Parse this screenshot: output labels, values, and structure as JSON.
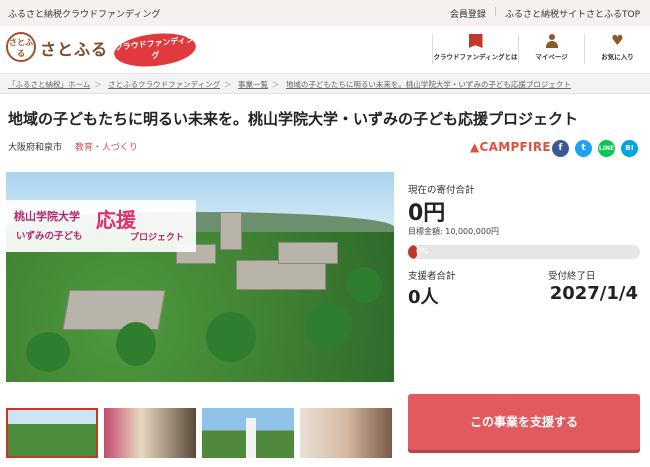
{
  "topbar": {
    "tagline": "ふるさと納税クラウドファンディング",
    "links": [
      "会員登録",
      "ふるさと納税サイトさとふるTOP"
    ]
  },
  "header": {
    "logo_mark": "さとふる",
    "logo_text": "さとふる",
    "cf_badge": "クラウドファンディング",
    "nav": [
      {
        "label": "クラウドファンディングとは",
        "icon": "book-icon"
      },
      {
        "label": "マイページ",
        "icon": "person-icon"
      },
      {
        "label": "お気に入り",
        "icon": "heart-icon"
      }
    ]
  },
  "breadcrumb": [
    "「ふるさと納税」ホーム",
    "さとふるクラウドファンディング",
    "事業一覧",
    "地域の子どもたちに明るい未来を。桃山学院大学・いずみの子ども応援プロジェクト"
  ],
  "project": {
    "title": "地域の子どもたちに明るい未来を。桃山学院大学・いずみの子ども応援プロジェクト",
    "location": "大阪府和泉市",
    "category": "教育・人づくり",
    "platform": "CAMPFIRE",
    "banner_line1": "桃山学院大学",
    "banner_line2": "いずみの子ども",
    "banner_big": "応援",
    "banner_small": "プロジェクト"
  },
  "share": {
    "facebook": "f",
    "twitter": "t",
    "line": "LINE",
    "hatena": "B!"
  },
  "stats": {
    "current_label": "現在の寄付合計",
    "current_value": "0円",
    "target_text": "目標金額: 10,000,000円",
    "progress_percent": 0,
    "progress_label": "0%",
    "supporters_label": "支援者合計",
    "supporters_value": "0人",
    "end_label": "受付終了日",
    "end_value": "2027/1/4"
  },
  "cta": {
    "label": "この事業を支援する"
  },
  "colors": {
    "accent": "#e05a5e",
    "brand": "#7a4a2a",
    "category": "#d9534f"
  }
}
